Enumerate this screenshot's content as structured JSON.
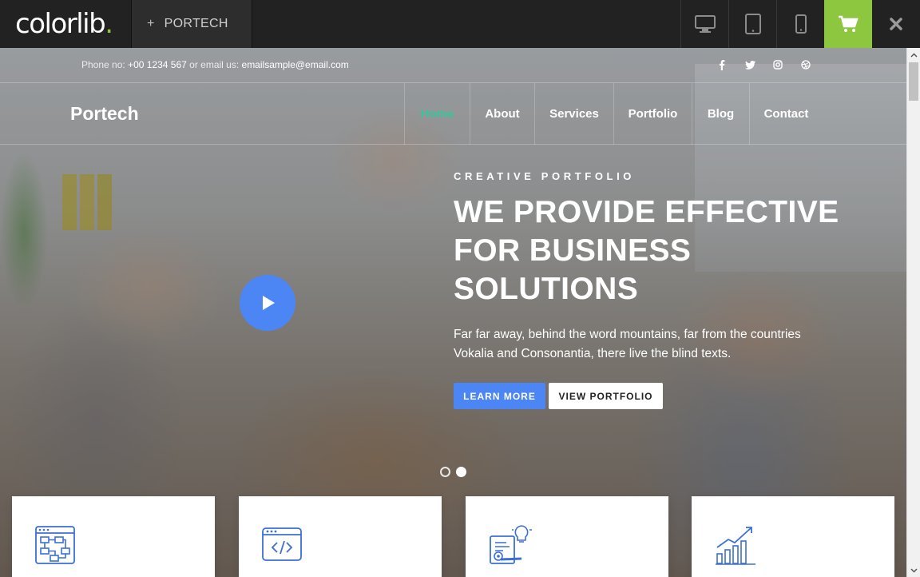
{
  "topbar": {
    "brand_name": "colorlib",
    "brand_dot": ".",
    "theme_tab_label": "PORTECH",
    "plus_glyph": "+",
    "devices": [
      "desktop-icon",
      "tablet-icon",
      "mobile-icon"
    ],
    "cart_icon": "cart-icon",
    "close_icon": "close-icon",
    "accent_color": "#8dc63f"
  },
  "contact": {
    "phone_label": "Phone no: ",
    "phone": "+00 1234 567",
    "email_label": " or email us: ",
    "email": "emailsample@email.com",
    "socials": [
      "facebook-icon",
      "twitter-icon",
      "instagram-icon",
      "dribbble-icon"
    ]
  },
  "nav": {
    "logo": "Portech",
    "items": [
      {
        "label": "Home",
        "active": true
      },
      {
        "label": "About",
        "active": false
      },
      {
        "label": "Services",
        "active": false
      },
      {
        "label": "Portfolio",
        "active": false
      },
      {
        "label": "Blog",
        "active": false
      },
      {
        "label": "Contact",
        "active": false
      }
    ],
    "active_color": "#37c59b"
  },
  "hero": {
    "kicker": "CREATIVE PORTFOLIO",
    "headline_1": "WE PROVIDE EFFECTIVE",
    "headline_2": "FOR BUSINESS",
    "headline_3": "SOLUTIONS",
    "lead_1": "Far far away, behind the word mountains, far from the countries",
    "lead_2": "Vokalia and Consonantia, there live the blind texts.",
    "primary_button": "LEARN MORE",
    "secondary_button": "VIEW PORTFOLIO",
    "play_icon": "play-icon",
    "button_color": "#4c86f4",
    "slides": 2,
    "active_slide": 2
  },
  "cards": [
    {
      "icon": "flowchart-icon"
    },
    {
      "icon": "code-window-icon"
    },
    {
      "icon": "idea-document-icon"
    },
    {
      "icon": "growth-chart-icon"
    }
  ]
}
